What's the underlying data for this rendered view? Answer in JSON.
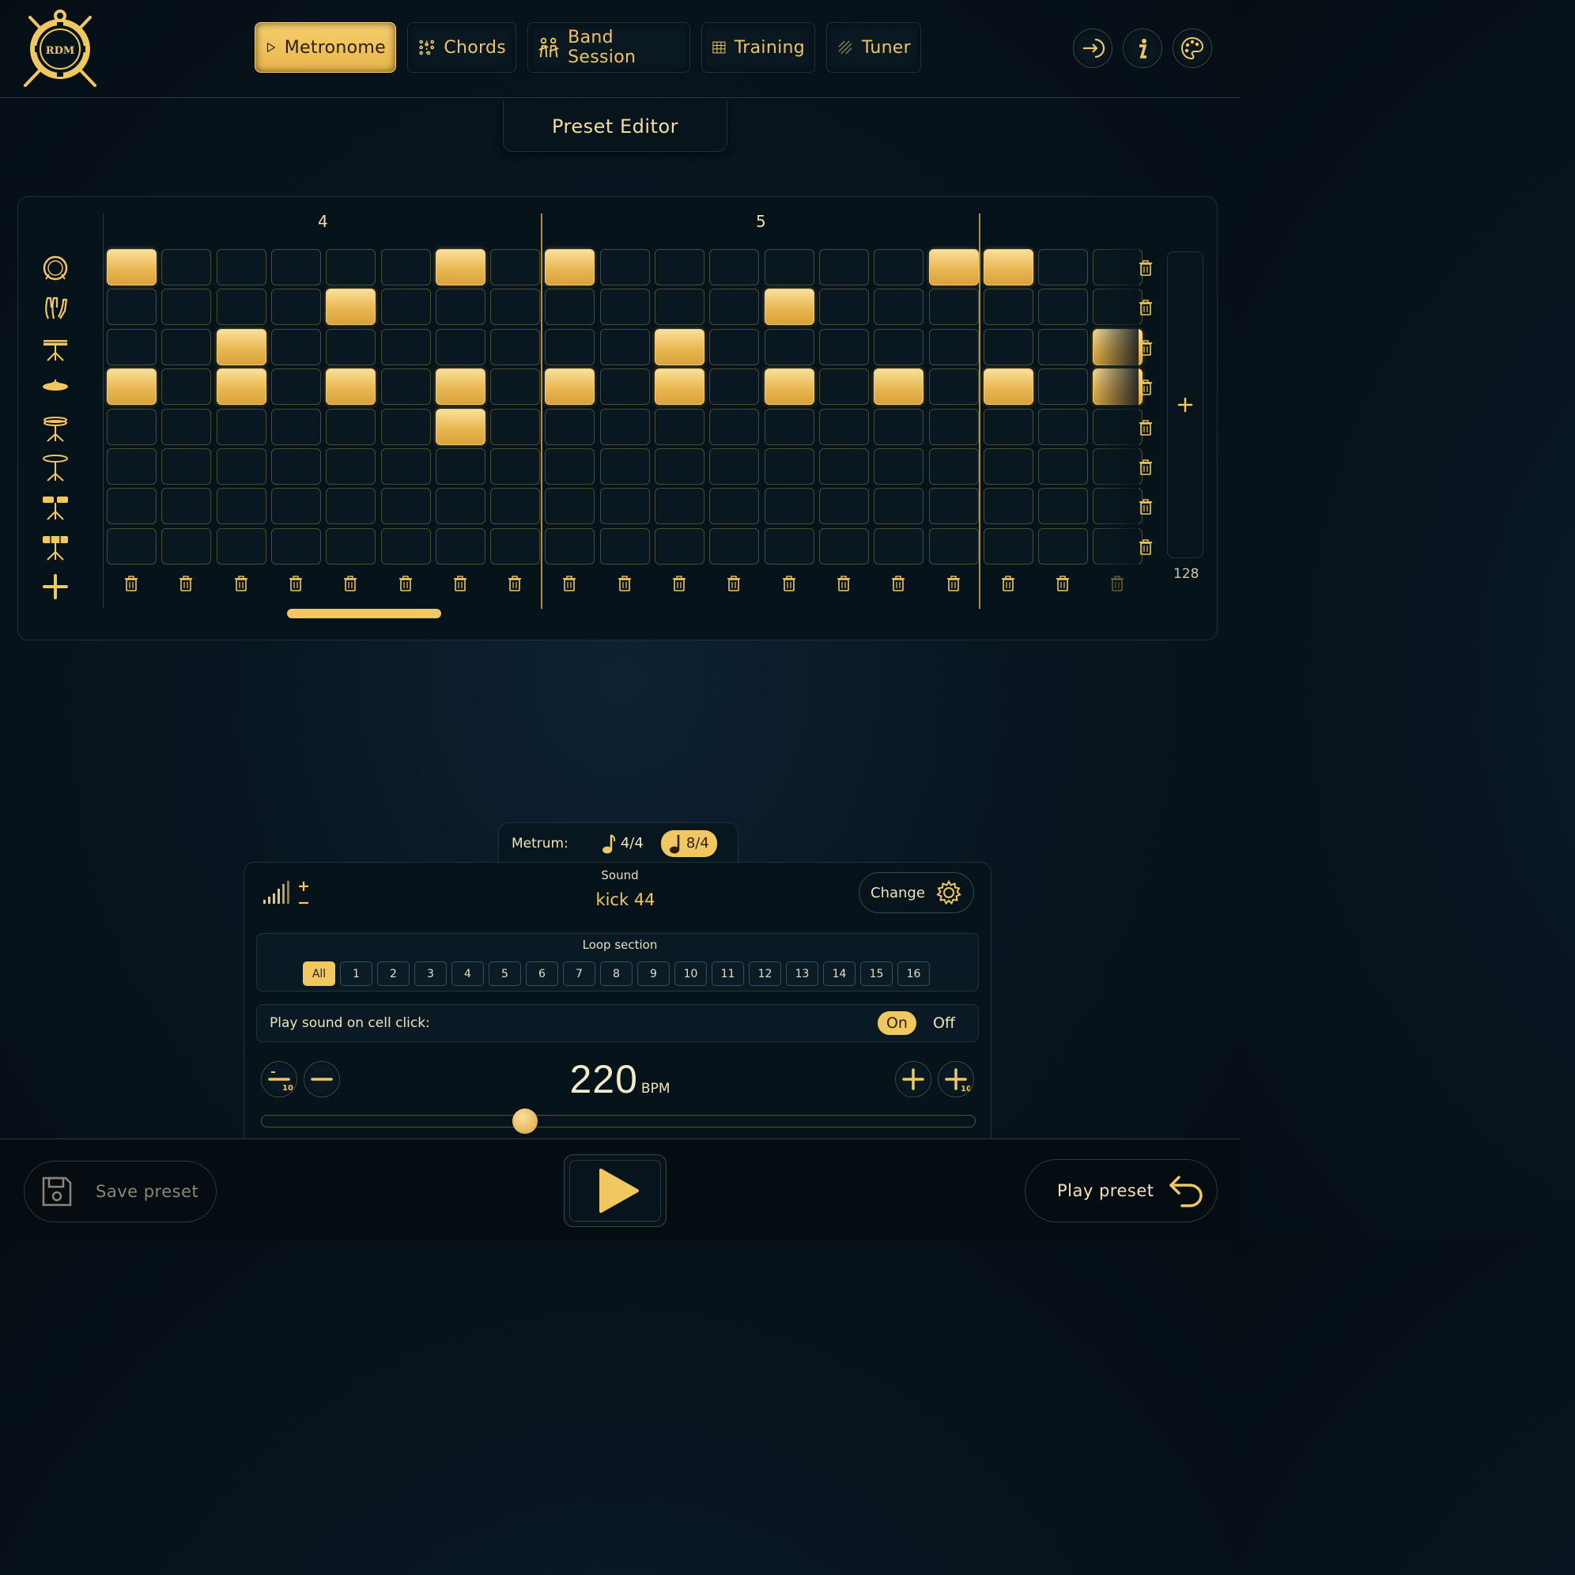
{
  "nav": {
    "logo_text": "RDM",
    "tabs": [
      {
        "label": "Metronome",
        "icon": "play-icon",
        "active": true
      },
      {
        "label": "Chords",
        "icon": "chords-icon",
        "active": false
      },
      {
        "label": "Band Session",
        "icon": "band-icon",
        "active": false
      },
      {
        "label": "Training",
        "icon": "training-icon",
        "active": false
      },
      {
        "label": "Tuner",
        "icon": "tuner-icon",
        "active": false
      }
    ],
    "right_buttons": [
      "login-icon",
      "info-icon",
      "palette-icon"
    ]
  },
  "editor": {
    "title": "Preset Editor",
    "measures": [
      "4",
      "5"
    ],
    "instruments": [
      "bass-drum-icon",
      "hand-clap-icon",
      "snare-icon",
      "cymbal-icon",
      "hi-hat-icon",
      "ride-cymbal-icon",
      "tom-icon",
      "floor-tom-icon"
    ],
    "active_cells": [
      [
        0,
        6,
        8,
        15,
        16
      ],
      [
        4,
        12
      ],
      [
        2,
        10,
        18
      ],
      [
        0,
        2,
        4,
        6,
        8,
        10,
        12,
        14,
        16,
        18
      ],
      [
        6
      ],
      [],
      [],
      []
    ],
    "column_count": 19,
    "length_value": "128",
    "scroll_position": 0.15
  },
  "metrum": {
    "label": "Metrum:",
    "options": [
      {
        "label": "4/4",
        "active": false
      },
      {
        "label": "8/4",
        "active": true
      }
    ]
  },
  "sound": {
    "label": "Sound",
    "name": "kick 44",
    "change_label": "Change"
  },
  "loop": {
    "label": "Loop section",
    "options": [
      "All",
      "1",
      "2",
      "3",
      "4",
      "5",
      "6",
      "7",
      "8",
      "9",
      "10",
      "11",
      "12",
      "13",
      "14",
      "15",
      "16"
    ],
    "active": "All"
  },
  "play_sound": {
    "label": "Play sound on cell click:",
    "on": "On",
    "off": "Off",
    "state": "On"
  },
  "tempo": {
    "bpm": "220",
    "unit": "BPM",
    "step_small": "10",
    "slider_fraction": 0.37
  },
  "bottom": {
    "save_label": "Save preset",
    "play_preset_label": "Play preset"
  },
  "colors": {
    "accent": "#f1c75f",
    "background": "#07131b"
  }
}
